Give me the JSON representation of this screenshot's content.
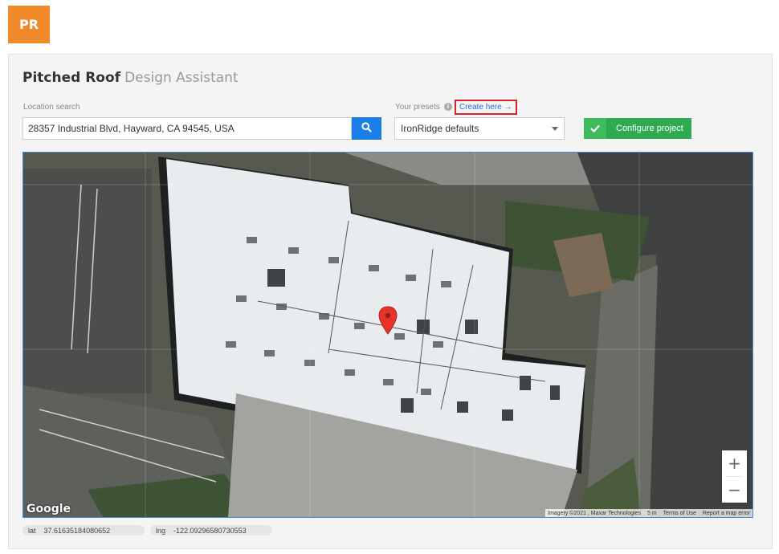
{
  "logo": {
    "text": "PR"
  },
  "header": {
    "title_main": "Pitched Roof",
    "title_sub": "Design Assistant"
  },
  "location": {
    "label": "Location search",
    "value": "28357 Industrial Blvd, Hayward, CA 94545, USA"
  },
  "presets": {
    "label": "Your presets",
    "create_link": "Create here →",
    "selected": "IronRidge defaults"
  },
  "configure": {
    "label": "Configure project"
  },
  "map": {
    "brand": "Google",
    "attribution": "Imagery ©2021 , Maxar Technologies",
    "scale": "5 m",
    "terms": "Terms of Use",
    "report": "Report a map error",
    "zoom_in": "+",
    "zoom_out": "−"
  },
  "coords": {
    "lat_label": "lat",
    "lat": "37.61635184080652",
    "lng_label": "lng",
    "lng": "-122.09296580730553"
  },
  "colors": {
    "accent": "#f0892a",
    "primary": "#1a7ee8",
    "success": "#2faa4f",
    "marker": "#e8332b"
  }
}
